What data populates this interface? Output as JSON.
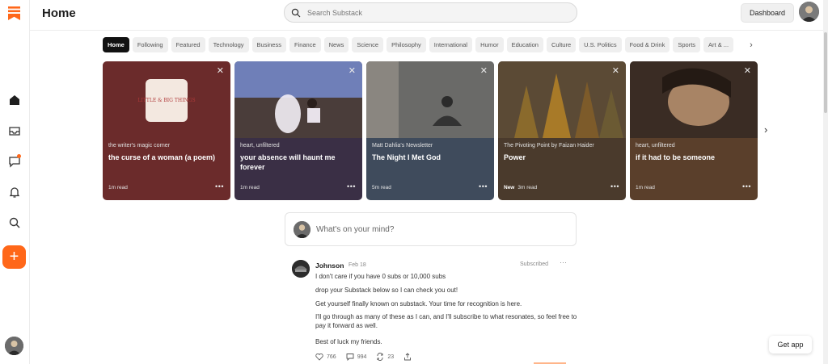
{
  "header": {
    "title": "Home",
    "search_placeholder": "Search Substack",
    "dashboard_label": "Dashboard"
  },
  "rail": {
    "icons": [
      "substack-logo",
      "home-icon",
      "inbox-icon",
      "chat-icon",
      "bell-icon",
      "search-icon",
      "compose-icon"
    ],
    "compose_label": "+"
  },
  "categories": [
    "Home",
    "Following",
    "Featured",
    "Technology",
    "Business",
    "Finance",
    "News",
    "Science",
    "Philosophy",
    "International",
    "Humor",
    "Education",
    "Culture",
    "U.S. Politics",
    "Food & Drink",
    "Sports",
    "Art & ..."
  ],
  "active_category": "Home",
  "cards": [
    {
      "publication": "the writer's magic corner",
      "title": "the curse of a woman (a poem)",
      "read_time": "1m read",
      "badge": "",
      "bg": "#6b2b2b",
      "art_text": "LITTLE & BIG THINGS"
    },
    {
      "publication": "heart, unfiltered",
      "title": "your absence will haunt me forever",
      "read_time": "1m read",
      "badge": "",
      "bg": "#3a2f45",
      "art_text": ""
    },
    {
      "publication": "Matt Dahlia's Newsletter",
      "title": "The Night I Met God",
      "read_time": "5m read",
      "badge": "",
      "bg": "#3f4b5c",
      "art_text": ""
    },
    {
      "publication": "The Pivoting Point by Faizan Haider",
      "title": "Power",
      "read_time": "3m read",
      "badge": "New",
      "bg": "#4a3a2c",
      "art_text": ""
    },
    {
      "publication": "heart, unfiltered",
      "title": "if it had to be someone",
      "read_time": "1m read",
      "badge": "",
      "bg": "#5a3f2b",
      "art_text": ""
    }
  ],
  "composer": {
    "placeholder": "What's on your mind?"
  },
  "post": {
    "author": "Johnson",
    "date": "Feb 18",
    "status": "Subscribed",
    "lines": [
      "I don't care if you have 0 subs or 10,000 subs",
      "drop your Substack below so I can check you out!",
      "Get yourself finally known on substack. Your time for recognition is here.",
      "I'll go through as many of these as I can, and I'll subscribe to what resonates, so feel free to pay it forward as well.",
      "Best of luck my friends."
    ],
    "likes": "766",
    "comments": "994",
    "restacks": "23"
  },
  "get_app_label": "Get app",
  "colors": {
    "accent": "#ff6719"
  }
}
